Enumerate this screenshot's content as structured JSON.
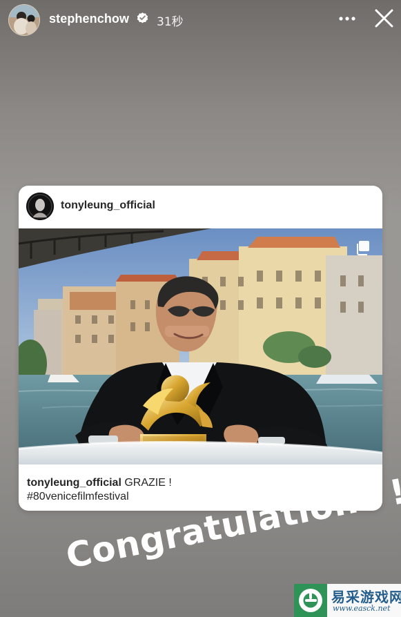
{
  "story": {
    "username": "stephenchow",
    "time_ago": "31秒",
    "verified": true,
    "avatar_icon": "profile-photo",
    "more_icon": "more-horizontal-icon",
    "close_icon": "close-icon"
  },
  "post": {
    "username": "tonyleung_official",
    "avatar_icon": "profile-photo",
    "media_type_icon": "carousel-icon",
    "photo_description_icon": "photo",
    "caption": {
      "user": "tonyleung_official",
      "text": "GRAZIE !",
      "hashtag": "#80venicefilmfestival"
    }
  },
  "sticker": {
    "text": "Congratulations !"
  },
  "watermark": {
    "title": "易采游戏网",
    "url": "www.easck.net",
    "icon": "site-logo-icon"
  },
  "colors": {
    "background_top": "#6f6c69",
    "background_middle": "#9a9895",
    "background_bottom": "#7e7c7a",
    "card_background": "#ffffff",
    "text_dark": "#262626",
    "watermark_blue": "#245e8d",
    "watermark_green": "#2f9358"
  }
}
